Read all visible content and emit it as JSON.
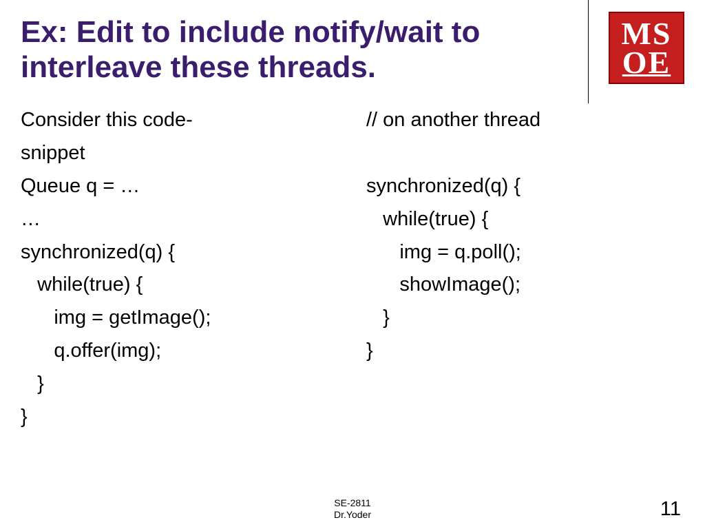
{
  "title": "Ex: Edit to include notify/wait to interleave these threads.",
  "logo": {
    "line1": "MS",
    "line2": "OE"
  },
  "left": {
    "l0": "Consider this code-",
    "l1": "snippet",
    "l2": "Queue q = …",
    "l3": "…",
    "l4": "synchronized(q) {",
    "l5": "   while(true) {",
    "l6": "      img = getImage();",
    "l7": "      q.offer(img);",
    "l8": "   }",
    "l9": "}"
  },
  "right": {
    "l0": "// on another thread",
    "l1": " ",
    "l2": "synchronized(q) {",
    "l3": "   while(true) {",
    "l4": "      img = q.poll();",
    "l5": "      showImage();",
    "l6": "   }",
    "l7": "}"
  },
  "footer": {
    "line1": "SE-2811",
    "line2": "Dr.Yoder"
  },
  "page": "11"
}
